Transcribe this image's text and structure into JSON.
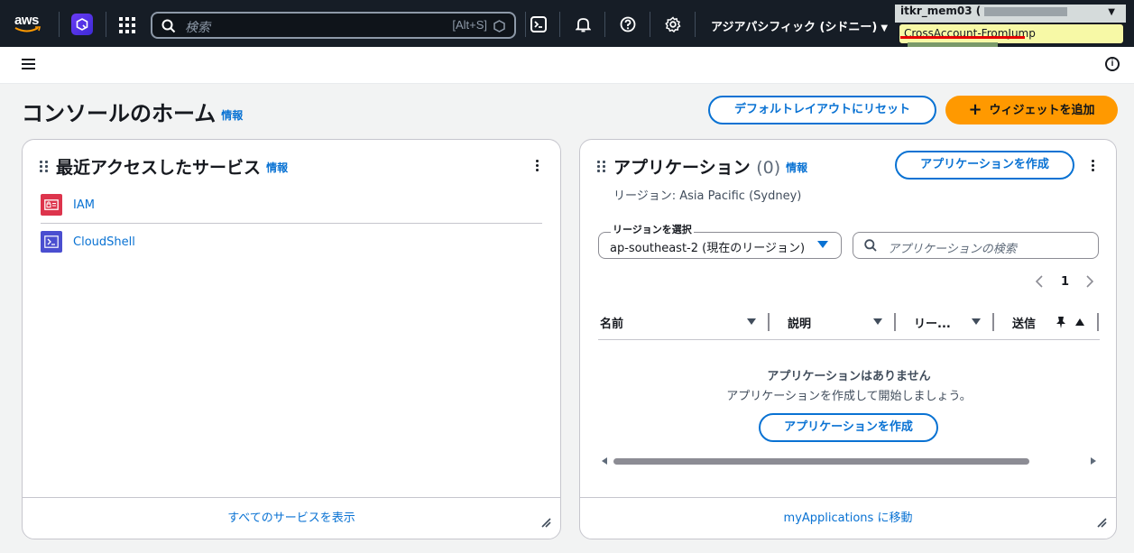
{
  "topnav": {
    "logo": "aws",
    "search_placeholder": "検索",
    "search_shortcut": "[Alt+S]",
    "region": "アジアパシフィック (シドニー)",
    "account_user": "itkr_mem03 (",
    "account_role": "CrossAccount-FromJump"
  },
  "page": {
    "title": "コンソールのホーム",
    "info": "情報",
    "reset_button": "デフォルトレイアウトにリセット",
    "add_widget_button": "ウィジェットを追加"
  },
  "recent": {
    "title": "最近アクセスしたサービス",
    "info": "情報",
    "items": [
      {
        "label": "IAM",
        "color": "#dd344c"
      },
      {
        "label": "CloudShell",
        "color": "#4a4ed0"
      }
    ],
    "footer": "すべてのサービスを表示"
  },
  "apps": {
    "title": "アプリケーション",
    "count": "(0)",
    "info": "情報",
    "create_button": "アプリケーションを作成",
    "region_text": "リージョン: Asia Pacific (Sydney)",
    "region_select_label": "リージョンを選択",
    "region_select_value": "ap-southeast-2 (現在のリージョン)",
    "search_placeholder": "アプリケーションの検索",
    "page_number": "1",
    "columns": [
      "名前",
      "説明",
      "リー...",
      "送信"
    ],
    "empty_title": "アプリケーションはありません",
    "empty_sub": "アプリケーションを作成して開始しましょう。",
    "empty_create_button": "アプリケーションを作成",
    "footer": "myApplications に移動"
  },
  "colors": {
    "nav_bg": "#161d26",
    "link": "#0972d3",
    "primary": "#ff9900"
  }
}
